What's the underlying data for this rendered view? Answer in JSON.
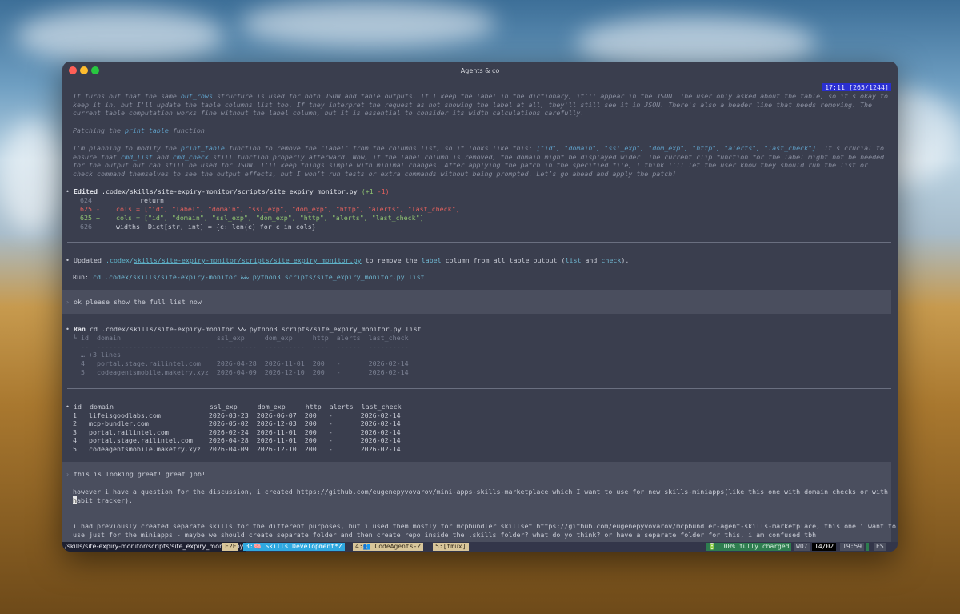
{
  "window": {
    "title": "Agents & co"
  },
  "header": {
    "clock": "17:11 [265/1244]"
  },
  "thinking": {
    "para1_a": "It turns out that the same ",
    "para1_code": "out_rows",
    "para1_b": " structure is used for both JSON and table outputs. If I keep the label in the dictionary, it’ll appear in the JSON. The user only asked about the table, so it's okay to keep it in, but I'll update the table columns list too. If they interpret the request as not showing the label at all, they'll still see it in JSON. There's also a header line that needs removing. The current table computation works fine without the label column, but it is essential to consider its width calculations carefully.",
    "heading2_a": "Patching the ",
    "heading2_code": "print_table",
    "heading2_b": " function",
    "para2_a": "I'm planning to modify the ",
    "para2_code1": "print_table",
    "para2_b": " function to remove the \"label\" from the columns list, so it looks like this: ",
    "para2_code2": "[\"id\", \"domain\", \"ssl_exp\", \"dom_exp\", \"http\", \"alerts\", \"last_check\"]",
    "para2_c": ". It's crucial to ensure that ",
    "para2_code3": "cmd_list",
    "para2_d": " and ",
    "para2_code4": "cmd_check",
    "para2_e": " still function properly afterward. Now, if the label column is removed, the domain might be displayed wider. The current clip function for the label might not be needed for the output but can still be used for JSON. I’ll keep things simple with minimal changes. After applying the patch in the specified file, I think I’ll let the user know they should run the list or check command themselves to see the output effects, but I won’t run tests or extra commands without being prompted. Let’s go ahead and apply the patch!"
  },
  "edit": {
    "verb": "Edited",
    "path": ".codex/skills/site-expiry-monitor/scripts/site_expiry_monitor.py",
    "stats": "(+1 -1)",
    "lines": [
      {
        "num": "624",
        "mark": " ",
        "text": "    return",
        "kind": "ctx"
      },
      {
        "num": "625",
        "mark": "-",
        "text": "cols = [\"id\", \"label\", \"domain\", \"ssl_exp\", \"dom_exp\", \"http\", \"alerts\", \"last_check\"]",
        "kind": "del"
      },
      {
        "num": "625",
        "mark": "+",
        "text": "cols = [\"id\", \"domain\", \"ssl_exp\", \"dom_exp\", \"http\", \"alerts\", \"last_check\"]",
        "kind": "add"
      },
      {
        "num": "626",
        "mark": " ",
        "text": "widths: Dict[str, int] = {c: len(c) for c in cols}",
        "kind": "ctx"
      }
    ]
  },
  "updated": {
    "prefix": "Updated ",
    "path1": ".codex/",
    "path2": "skills/site-expiry-monitor/scripts/site_expiry_monitor.py",
    "mid": " to remove the ",
    "label_word": "label",
    "tail1": " column from all table output (",
    "list_word": "list",
    "and_word": " and ",
    "check_word": "check",
    "tail2": ").",
    "run_label": "Run: ",
    "run_cmd": "cd .codex/skills/site-expiry-monitor && python3 scripts/site_expiry_monitor.py list"
  },
  "prompt1": "ok please show the full list now",
  "ran": {
    "verb": "Ran",
    "cmd": "cd .codex/skills/site-expiry-monitor && python3 scripts/site_expiry_monitor.py list",
    "out": [
      "└ id  domain                        ssl_exp     dom_exp     http  alerts  last_check",
      "  --  ----------------------------  ----------  ----------  ----  ------  ----------",
      "  … +3 lines",
      "  4   portal.stage.railintel.com    2026-04-28  2026-11-01  200   -       2026-02-14",
      "  5   codeagentsmobile.maketry.xyz  2026-04-09  2026-12-10  200   -       2026-02-14"
    ]
  },
  "table": {
    "header": "id  domain                        ssl_exp     dom_exp     http  alerts  last_check",
    "rows": [
      "1   lifeisgoodlabs.com            2026-03-23  2026-06-07  200   -       2026-02-14",
      "2   mcp-bundler.com               2026-05-02  2026-12-03  200   -       2026-02-14",
      "3   portal.railintel.com          2026-02-24  2026-11-01  200   -       2026-02-14",
      "4   portal.stage.railintel.com    2026-04-28  2026-11-01  200   -       2026-02-14",
      "5   codeagentsmobile.maketry.xyz  2026-04-09  2026-12-10  200   -       2026-02-14"
    ]
  },
  "prompt2": {
    "line1": "this is looking great! great job!",
    "line2": "however i have a question for the discussion, i created https://github.com/eugenepyvovarov/mini-apps-skills-marketplace which I want to use for new skills-miniapps(like this one with domain checks or with",
    "line3_cursor": "h",
    "line3": "abit tracker).",
    "line4": "i had previously created separate skills for the different purposes, but i used them mostly for mcpbundler skillset https://github.com/eugenepyvovarov/mcpbundler-agent-skills-marketplace, this one i want to",
    "line5": "use just for the miniapps - maybe we should create separate folder and then create repo inside the .skills folder? what do yo think? or have a separate folder for this, i am confused tbh"
  },
  "statusbar": {
    "path_tooltip": "/skills/site-expiry-monitor/scripts/site_expiry_monitor.py",
    "f2f": "F2F",
    "tab3": "3:🧠 Skills Development*Z",
    "tab4": "4:👥 CodeAgents-Z",
    "tab5": "5:[tmux]",
    "battery": "🔋 100% fully charged",
    "week": "W07",
    "date": "14/02",
    "time": "19:59",
    "lang": "ES",
    "colors": {
      "tab3_bg": "#2fa8e0",
      "tab4_bg": "#d8c69a",
      "battery_bg": "#2e7d4f",
      "date_bg": "#000000"
    }
  }
}
